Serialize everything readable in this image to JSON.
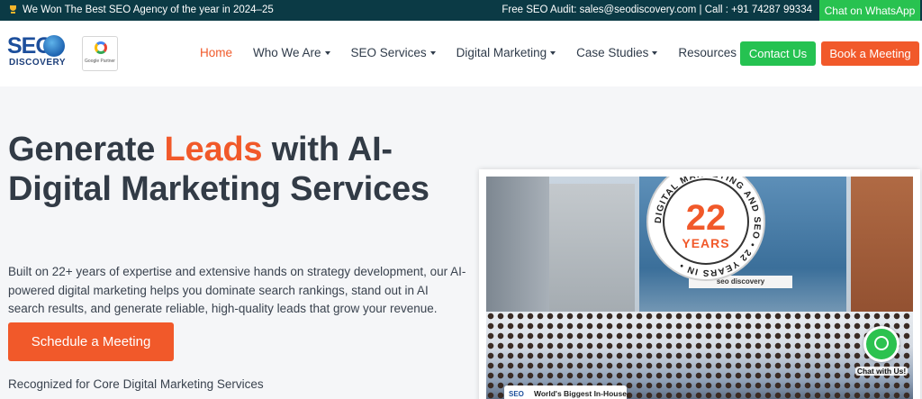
{
  "topbar": {
    "announcement": "We Won The Best SEO Agency of the year in 2024–25",
    "contact": "Free SEO Audit: sales@seodiscovery.com | Call : +91 74287 99334",
    "whatsapp_label": "Chat on WhatsApp"
  },
  "header": {
    "logo": {
      "line1": "SEO",
      "line2": "DISCOVERY"
    },
    "partner_badge": "Google Partner",
    "nav": [
      {
        "label": "Home",
        "active": true,
        "dropdown": false
      },
      {
        "label": "Who We Are",
        "dropdown": true
      },
      {
        "label": "SEO Services",
        "dropdown": true
      },
      {
        "label": "Digital Marketing",
        "dropdown": true
      },
      {
        "label": "Case Studies",
        "dropdown": true
      },
      {
        "label": "Resources",
        "dropdown": true
      }
    ],
    "contact_button": "Contact Us",
    "book_button": "Book a Meeting"
  },
  "hero": {
    "title_part1": "Generate ",
    "title_accent": "Leads",
    "title_part2": " with AI-Digital Marketing Services",
    "description": "Built on 22+ years of expertise and extensive hands on strategy development, our AI-powered digital marketing helps you dominate search rankings, stand out in AI search results, and generate reliable, high-quality leads that grow your revenue.",
    "cta": "Schedule a Meeting",
    "recognized": "Recognized for Core Digital Marketing Services"
  },
  "photo": {
    "badge_number": "22",
    "badge_years": "YEARS",
    "badge_ring": "DIGITAL MARKETING AND SEO • 22 YEARS IN •",
    "signboard": "seo discovery",
    "bottom_tag_logo": "SEO",
    "bottom_tag_text": "World's Biggest In-House Digital Marketing Team"
  },
  "chat_float": {
    "label": "Chat with Us!"
  },
  "colors": {
    "accent": "#f1592a",
    "green": "#25c251",
    "topbar": "#0b3a45"
  }
}
